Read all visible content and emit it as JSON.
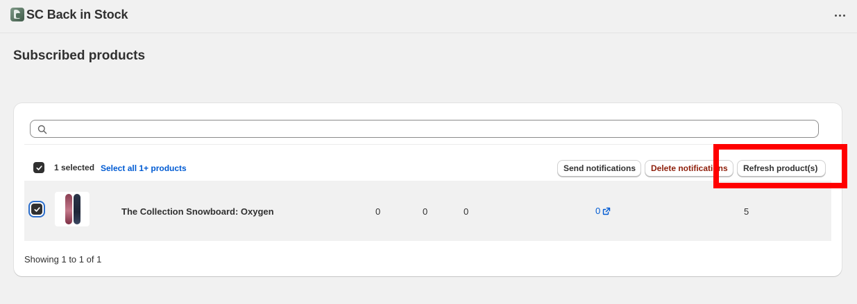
{
  "app": {
    "title": "SC Back in Stock",
    "icon": "app-logo-icon",
    "menu_icon": "more-horizontal-icon"
  },
  "page": {
    "title": "Subscribed products"
  },
  "search": {
    "value": "",
    "placeholder": "",
    "icon": "search-icon"
  },
  "bulk_actions": {
    "selected_label": "1 selected",
    "select_all_label": "Select all 1+ products",
    "send_label": "Send notifications",
    "delete_label": "Delete notifications",
    "refresh_label": "Refresh product(s)"
  },
  "products": [
    {
      "name": "The Collection Snowboard: Oxygen",
      "selected": true,
      "col1": "0",
      "col2": "0",
      "col3": "0",
      "notifications": "0",
      "col5": "5"
    }
  ],
  "pagination": {
    "text": "Showing 1 to 1 of 1"
  },
  "colors": {
    "accent": "#005bd3",
    "critical": "#8e1f0b",
    "highlight": "#ff0000",
    "background": "#f1f1f1"
  }
}
